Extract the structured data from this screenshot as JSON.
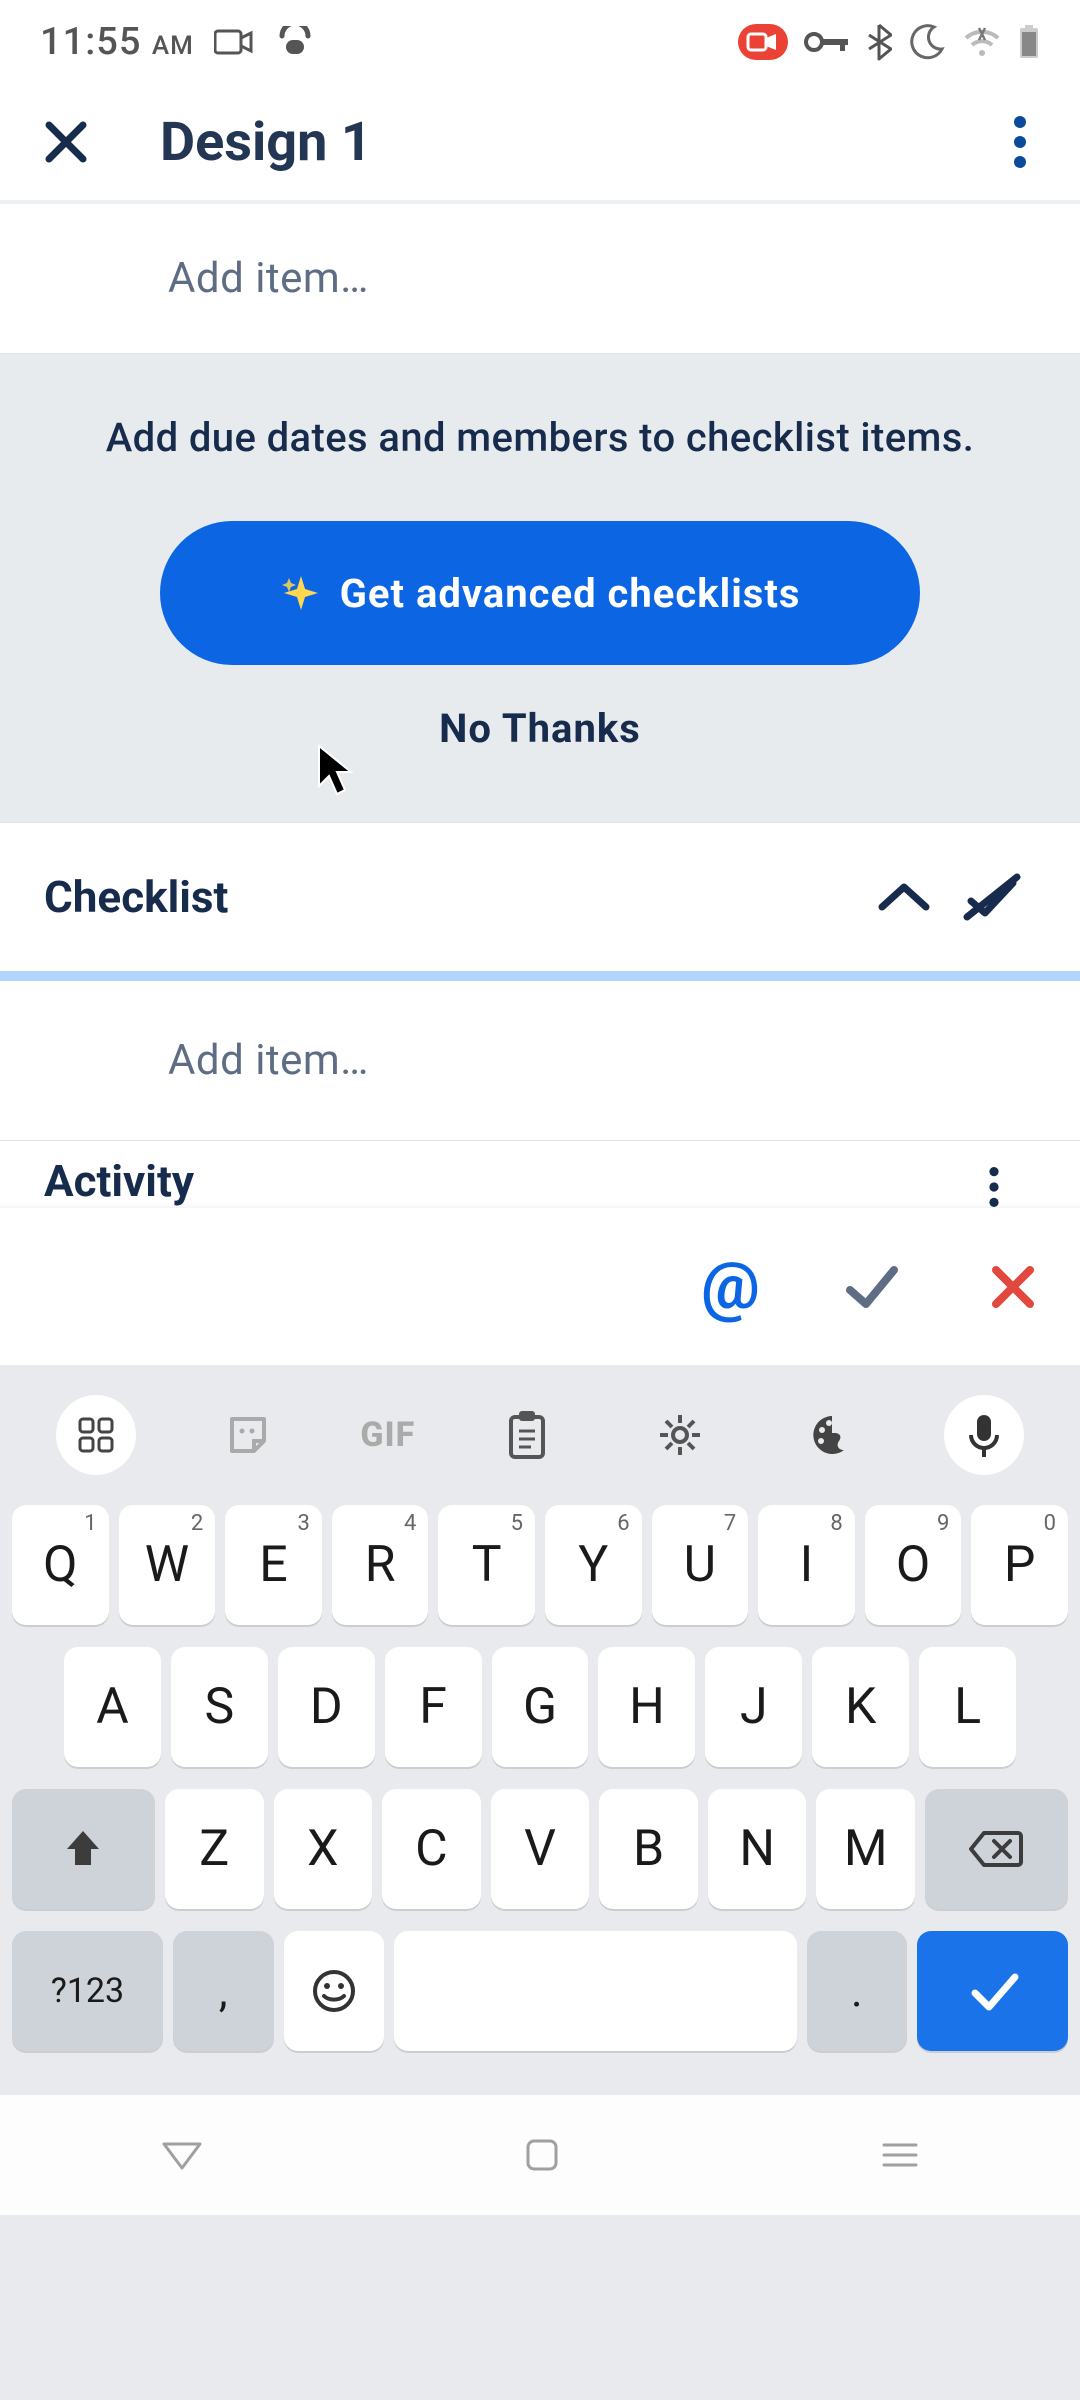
{
  "status": {
    "time": "11:55",
    "ampm": "AM"
  },
  "header": {
    "title": "Design 1"
  },
  "add_item_placeholder": "Add item…",
  "promo": {
    "text": "Add due dates and members to checklist items.",
    "primary_label": "Get advanced checklists",
    "secondary_label": "No Thanks"
  },
  "checklist": {
    "label": "Checklist"
  },
  "activity": {
    "label": "Activity"
  },
  "keyboard": {
    "gif_label": "GIF",
    "row1": [
      {
        "k": "Q",
        "s": "1"
      },
      {
        "k": "W",
        "s": "2"
      },
      {
        "k": "E",
        "s": "3"
      },
      {
        "k": "R",
        "s": "4"
      },
      {
        "k": "T",
        "s": "5"
      },
      {
        "k": "Y",
        "s": "6"
      },
      {
        "k": "U",
        "s": "7"
      },
      {
        "k": "I",
        "s": "8"
      },
      {
        "k": "O",
        "s": "9"
      },
      {
        "k": "P",
        "s": "0"
      }
    ],
    "row2": [
      "A",
      "S",
      "D",
      "F",
      "G",
      "H",
      "J",
      "K",
      "L"
    ],
    "row3": [
      "Z",
      "X",
      "C",
      "V",
      "B",
      "N",
      "M"
    ],
    "sym": "?123",
    "comma": ",",
    "period": "."
  }
}
